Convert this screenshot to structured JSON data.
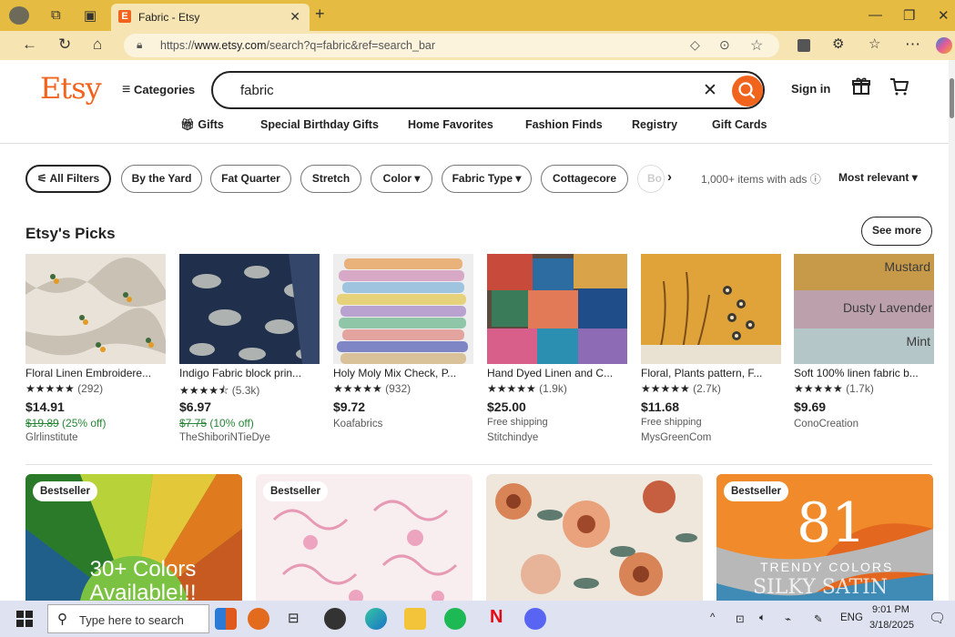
{
  "browser": {
    "tab_title": "Fabric - Etsy",
    "favicon_letter": "E",
    "url_prefix": "https://",
    "url_domain": "www.etsy.com",
    "url_path": "/search?q=fabric&ref=search_bar"
  },
  "header": {
    "logo": "Etsy",
    "categories_label": "Categories",
    "search_value": "fabric",
    "sign_in": "Sign in",
    "subnav": [
      "Gifts",
      "Special Birthday Gifts",
      "Home Favorites",
      "Fashion Finds",
      "Registry",
      "Gift Cards"
    ]
  },
  "filters": {
    "chips": [
      "All Filters",
      "By the Yard",
      "Fat Quarter",
      "Stretch",
      "Color ▾",
      "Fabric Type ▾",
      "Cottagecore",
      "Bo"
    ],
    "ads_note": "1,000+ items with ads ⓘ",
    "sort_label": "Most relevant ▾"
  },
  "picks": {
    "heading": "Etsy's Picks",
    "see_more": "See more",
    "items": [
      {
        "title": "Floral Linen Embroidere...",
        "stars": "★★★★★",
        "reviews": "(292)",
        "price": "$14.91",
        "orig": "$19.89",
        "discount": " (25% off)",
        "shipping": "",
        "shop": "Glrlinstitute"
      },
      {
        "title": "Indigo Fabric block prin...",
        "stars": "★★★★⯪",
        "reviews": "(5.3k)",
        "price": "$6.97",
        "orig": "$7.75",
        "discount": " (10% off)",
        "shipping": "",
        "shop": "TheShiboriNTieDye"
      },
      {
        "title": "Holy Moly Mix Check, P...",
        "stars": "★★★★★",
        "reviews": "(932)",
        "price": "$9.72",
        "orig": "",
        "discount": "",
        "shipping": "",
        "shop": "Koafabrics"
      },
      {
        "title": "Hand Dyed Linen and C...",
        "stars": "★★★★★",
        "reviews": "(1.9k)",
        "price": "$25.00",
        "orig": "",
        "discount": "",
        "shipping": "Free shipping",
        "shop": "Stitchindye"
      },
      {
        "title": "Floral, Plants pattern, F...",
        "stars": "★★★★★",
        "reviews": "(2.7k)",
        "price": "$11.68",
        "orig": "",
        "discount": "",
        "shipping": "Free shipping",
        "shop": "MysGreenCom"
      },
      {
        "title": "Soft 100% linen fabric b...",
        "stars": "★★★★★",
        "reviews": "(1.7k)",
        "price": "$9.69",
        "orig": "",
        "discount": "",
        "shipping": "",
        "shop": "ConoCreation"
      }
    ],
    "linen_labels": [
      "Mustard",
      "Dusty Lavender",
      "Mint"
    ]
  },
  "listing": {
    "badges": [
      "Bestseller",
      "Bestseller",
      "Bestseller"
    ],
    "image1_text": "30+ Colors Available!!!",
    "image4_number": "81",
    "image4_text1": "TRENDY COLORS",
    "image4_text2": "SILKY SATIN"
  },
  "taskbar": {
    "search_placeholder": "Type here to search",
    "lang": "ENG",
    "time": "9:01 PM",
    "date": "3/18/2025"
  },
  "colors": {
    "brand": "#f1641e",
    "titlebar": "#e6bb42",
    "sale": "#258635"
  }
}
